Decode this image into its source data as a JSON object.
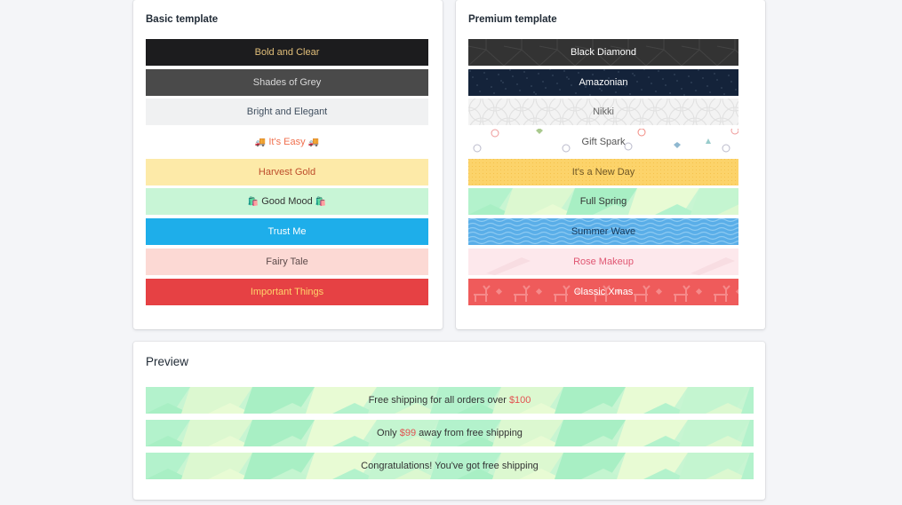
{
  "basic": {
    "title": "Basic template",
    "items": [
      {
        "label": "Bold and Clear",
        "bg": "#1c1c1e",
        "color": "#e2bf7a"
      },
      {
        "label": "Shades of Grey",
        "bg": "#4a4a4a",
        "color": "#d9d9d9"
      },
      {
        "label": "Bright and Elegant",
        "bg": "#f0f1f2",
        "color": "#3f4e5e"
      },
      {
        "label": "It's Easy",
        "bg": "#ffffff",
        "color": "#f0714f",
        "icon": "🚚"
      },
      {
        "label": "Harvest Gold",
        "bg": "#fdeaa8",
        "color": "#bd4d2b"
      },
      {
        "label": "Good Mood",
        "bg": "#c8f5d6",
        "color": "#333333",
        "icon": "🛍️"
      },
      {
        "label": "Trust Me",
        "bg": "#1eaeea",
        "color": "#ffffff"
      },
      {
        "label": "Fairy Tale",
        "bg": "#fcd9d4",
        "color": "#5c4a4a"
      },
      {
        "label": "Important Things",
        "bg": "#e64144",
        "color": "#ffd36b"
      }
    ]
  },
  "premium": {
    "title": "Premium template",
    "items": [
      {
        "label": "Black Diamond",
        "bg": "#333333",
        "color": "#ffffff",
        "pattern": "diamond"
      },
      {
        "label": "Amazonian",
        "bg": "#14233a",
        "color": "#ffffff",
        "pattern": "stars"
      },
      {
        "label": "Nikki",
        "bg": "#f3f3f3",
        "color": "#666666",
        "pattern": "waves-circle"
      },
      {
        "label": "Gift Spark",
        "bg": "#ffffff",
        "color": "#555555",
        "pattern": "confetti"
      },
      {
        "label": "It's a New Day",
        "bg": "#fcd36a",
        "color": "#6e5626",
        "pattern": "dots"
      },
      {
        "label": "Full Spring",
        "bg": "#c8f5d2",
        "color": "#333333",
        "pattern": "poly"
      },
      {
        "label": "Summer Wave",
        "bg": "#5aaee8",
        "color": "#123456",
        "pattern": "wave"
      },
      {
        "label": "Rose Makeup",
        "bg": "#fde8ec",
        "color": "#e05672",
        "pattern": "brush"
      },
      {
        "label": "Classic Xmas",
        "bg": "#ef5b5b",
        "color": "#ffffff",
        "pattern": "xmas"
      }
    ]
  },
  "preview": {
    "title": "Preview",
    "messages": [
      {
        "before": "Free shipping for all orders over ",
        "price": "$100",
        "after": ""
      },
      {
        "before": "Only ",
        "price": "$99",
        "after": " away from free shipping"
      },
      {
        "before": "Congratulations! You've got free shipping",
        "price": "",
        "after": ""
      }
    ]
  }
}
